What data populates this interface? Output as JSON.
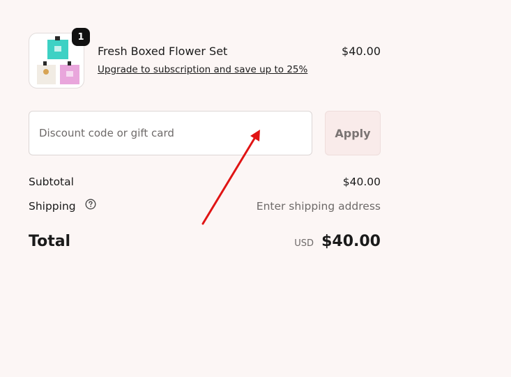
{
  "product": {
    "name": "Fresh Boxed Flower Set",
    "quantity": "1",
    "price": "$40.00",
    "upgrade_link": "Upgrade to subscription and save up to 25%"
  },
  "discount": {
    "placeholder": "Discount code or gift card",
    "value": "",
    "apply_label": "Apply"
  },
  "totals": {
    "subtotal_label": "Subtotal",
    "subtotal_value": "$40.00",
    "shipping_label": "Shipping",
    "shipping_value": "Enter shipping address",
    "total_label": "Total",
    "currency": "USD",
    "total_value": "$40.00"
  },
  "colors": {
    "background": "#fcf6f5",
    "apply_button": "#f9ebea",
    "annotation_arrow": "#e01414"
  }
}
